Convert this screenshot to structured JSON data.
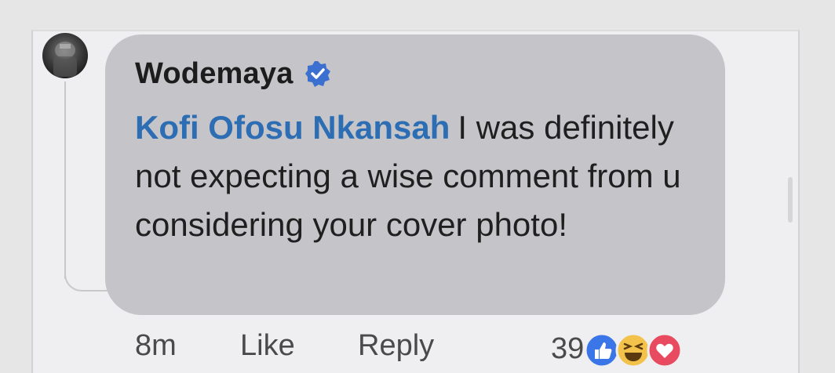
{
  "comment": {
    "author": "Wodemaya",
    "mention": "Kofi Ofosu Nkansah",
    "text": "I was definitely not expecting a wise comment from u considering your cover photo!",
    "time": "8m",
    "like_label": "Like",
    "reply_label": "Reply",
    "reaction_count": "39",
    "reactions": [
      "like-reaction-icon",
      "haha-reaction-icon",
      "love-reaction-icon"
    ]
  },
  "colors": {
    "mention": "#2c6db3",
    "verified": "#3b6fd0",
    "bubble": "#c5c5c9",
    "like": "#3b76e8",
    "haha": "#f2c24a",
    "love": "#e84a5f"
  }
}
